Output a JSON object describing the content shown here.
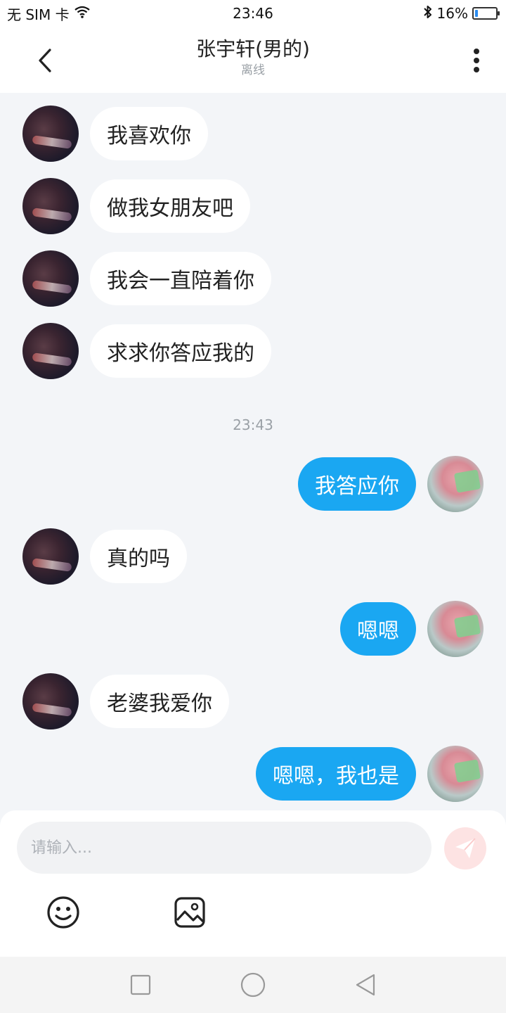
{
  "status_bar": {
    "carrier": "无 SIM 卡",
    "time": "23:46",
    "battery_percent": "16%",
    "battery_level": 0.16,
    "icons": [
      "wifi-icon",
      "bluetooth-icon",
      "battery-icon"
    ]
  },
  "header": {
    "title": "张宇轩(男的)",
    "subtitle": "离线",
    "icons": [
      "back-arrow-icon",
      "more-vertical-icon"
    ]
  },
  "messages": [
    {
      "sender": "other",
      "text": "我喜欢你"
    },
    {
      "sender": "other",
      "text": "做我女朋友吧"
    },
    {
      "sender": "other",
      "text": "我会一直陪着你"
    },
    {
      "sender": "other",
      "text": "求求你答应我的"
    },
    {
      "type": "timestamp",
      "text": "23:43"
    },
    {
      "sender": "me",
      "text": "我答应你"
    },
    {
      "sender": "other",
      "text": "真的吗"
    },
    {
      "sender": "me",
      "text": "嗯嗯"
    },
    {
      "sender": "other",
      "text": "老婆我爱你"
    },
    {
      "sender": "me",
      "text": "嗯嗯，我也是"
    }
  ],
  "composer": {
    "placeholder": "请输入...",
    "value": "",
    "icons": [
      "send-icon",
      "emoji-icon",
      "image-icon"
    ]
  },
  "colors": {
    "outgoing_bubble": "#1aa7f2",
    "incoming_bubble": "#ffffff",
    "chat_background": "#f3f5f8",
    "send_button": "#fde3e3"
  },
  "nav_bar": {
    "icons": [
      "recents-square-icon",
      "home-circle-icon",
      "back-triangle-icon"
    ]
  }
}
